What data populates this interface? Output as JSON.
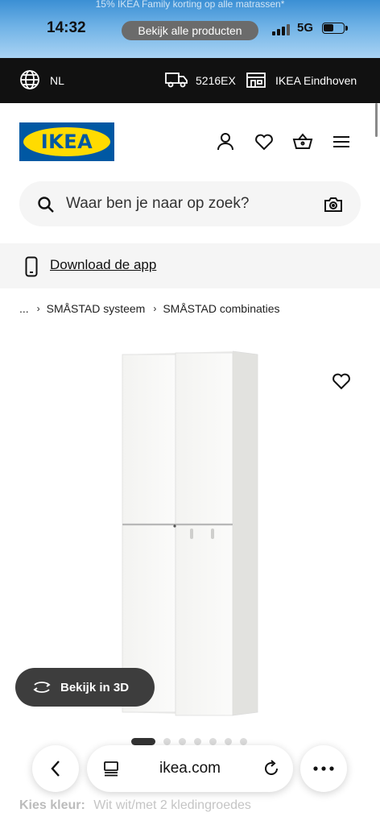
{
  "status_bar": {
    "promo_text": "15% IKEA Family korting op alle matrassen*",
    "time": "14:32",
    "pill_label": "Bekijk alle producten",
    "network": "5G"
  },
  "topbar": {
    "language": "NL",
    "postcode": "5216EX",
    "store": "IKEA Eindhoven"
  },
  "header": {
    "logo_text": "IKEA",
    "icons": [
      "user-icon",
      "heart-icon",
      "basket-icon",
      "menu-icon"
    ]
  },
  "search": {
    "placeholder": "Waar ben je naar op zoek?"
  },
  "app_banner": {
    "label": "Download de app"
  },
  "breadcrumb": {
    "items": [
      "...",
      "SMÅSTAD systeem",
      "SMÅSTAD combinaties"
    ]
  },
  "product": {
    "view_3d_label": "Bekijk in 3D",
    "carousel_total": 7,
    "carousel_active": 1
  },
  "color_selector": {
    "label": "Kies kleur:",
    "value": "Wit wit/met 2 kledingroedes"
  },
  "browser": {
    "url": "ikea.com"
  },
  "colors": {
    "ikea_blue": "#0058a3",
    "ikea_yellow": "#ffdb00",
    "topbar_bg": "#111111",
    "search_bg": "#f5f5f5"
  }
}
